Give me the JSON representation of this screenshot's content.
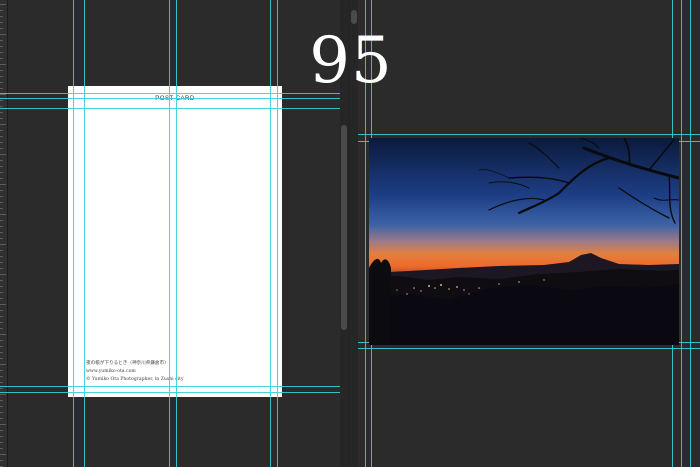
{
  "page_number": "95",
  "postcard": {
    "title": "POST CARD",
    "credits": [
      "夜の帳が下りるとき（神奈川県鎌倉市）",
      "www.yumiko-ota.com",
      "© Yumiko Ota Photographer, in Zushi city"
    ]
  },
  "colors": {
    "background": "#2b2b2b",
    "guide": "#31d0d6",
    "page": "#ffffff"
  },
  "photo": {
    "description_icon": "twilight-landscape-image"
  }
}
